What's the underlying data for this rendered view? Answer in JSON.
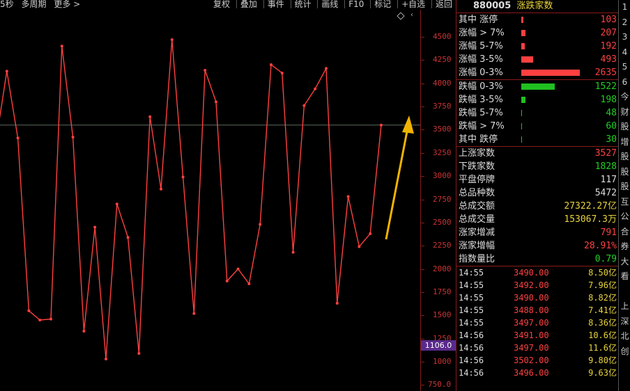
{
  "toolbar": {
    "left": [
      "5秒",
      "多周期",
      "更多 >"
    ],
    "right": [
      "复权",
      "叠加",
      "事件",
      "统计",
      "画线",
      "F10",
      "标记",
      "+自选",
      "返回"
    ]
  },
  "chart_data": {
    "type": "line",
    "ylim": [
      750,
      4600
    ],
    "yticks": [
      4500,
      4250,
      4000,
      3750,
      3500,
      3250,
      3000,
      2750,
      2500,
      2250,
      2000,
      1750,
      1500,
      1250,
      1000,
      750
    ],
    "ytick_labels": [
      "4500",
      "4250",
      "4000",
      "3750",
      "3500",
      "3250",
      "3000",
      "2750",
      "2500",
      "2250",
      "2000",
      "1750",
      "1500",
      "1250",
      "1000",
      "750.0"
    ],
    "series": [
      {
        "color": "#ff4040",
        "values": [
          3360,
          4130,
          3410,
          1550,
          1450,
          1460,
          4400,
          3420,
          1330,
          2450,
          1030,
          2700,
          2340,
          1090,
          3640,
          2860,
          4470,
          2990,
          1520,
          4140,
          3800,
          1870,
          2000,
          1840,
          2480,
          4200,
          4110,
          2180,
          3760,
          3940,
          4160,
          1630,
          2780,
          2240,
          2380,
          3550
        ]
      }
    ],
    "crosshair_value": 3550,
    "cursor_label": "1106.0",
    "annotation": "yellow-arrow"
  },
  "panel": {
    "code": "880005",
    "name": "涨跌家数",
    "up_rows": [
      {
        "label": "其中 涨停",
        "value": "103",
        "bar": 0.02
      },
      {
        "label": "涨幅 > 7%",
        "value": "207",
        "bar": 0.04
      },
      {
        "label": "涨幅 5-7%",
        "value": "192",
        "bar": 0.035
      },
      {
        "label": "涨幅 3-5%",
        "value": "493",
        "bar": 0.12
      },
      {
        "label": "涨幅 0-3%",
        "value": "2635",
        "bar": 0.61
      }
    ],
    "down_rows": [
      {
        "label": "跌幅 0-3%",
        "value": "1522",
        "bar": 0.35
      },
      {
        "label": "跌幅 3-5%",
        "value": "198",
        "bar": 0.04
      },
      {
        "label": "跌幅 5-7%",
        "value": "48",
        "bar": 0.005
      },
      {
        "label": "跌幅 > 7%",
        "value": "60",
        "bar": 0.005
      },
      {
        "label": "其中 跌停",
        "value": "30",
        "bar": 0.005
      }
    ],
    "stats": [
      {
        "label": "上涨家数",
        "value": "3527",
        "color": "red"
      },
      {
        "label": "下跌家数",
        "value": "1828",
        "color": "green"
      },
      {
        "label": "平盘停牌",
        "value": "117",
        "color": "white"
      },
      {
        "label": "总品种数",
        "value": "5472",
        "color": "white"
      },
      {
        "label": "总成交额",
        "value": "27322.27亿",
        "color": "yellow"
      },
      {
        "label": "总成交量",
        "value": "153067.3万",
        "color": "yellow"
      },
      {
        "label": "涨家增减",
        "value": "791",
        "color": "red"
      },
      {
        "label": "涨家增幅",
        "value": "28.91%",
        "color": "red"
      },
      {
        "label": "指数量比",
        "value": "0.79",
        "color": "green"
      }
    ],
    "ticks": [
      {
        "time": "14:55",
        "price": "3490.00",
        "amount": "8.50亿"
      },
      {
        "time": "14:55",
        "price": "3492.00",
        "amount": "7.96亿"
      },
      {
        "time": "14:55",
        "price": "3490.00",
        "amount": "8.82亿"
      },
      {
        "time": "14:55",
        "price": "3488.00",
        "amount": "7.41亿"
      },
      {
        "time": "14:55",
        "price": "3497.00",
        "amount": "8.36亿"
      },
      {
        "time": "14:56",
        "price": "3491.00",
        "amount": "10.6亿"
      },
      {
        "time": "14:56",
        "price": "3497.00",
        "amount": "11.6亿"
      },
      {
        "time": "14:56",
        "price": "3502.00",
        "amount": "9.80亿"
      },
      {
        "time": "14:56",
        "price": "3496.00",
        "amount": "9.63亿"
      }
    ]
  },
  "strip": [
    "1",
    "2",
    "3",
    "4",
    "5",
    "6",
    "今",
    "财",
    "股",
    "增",
    "股",
    "股",
    "股",
    "互",
    "公",
    "合",
    "券",
    "大",
    "看",
    "",
    "上",
    "深",
    "北",
    "创"
  ]
}
